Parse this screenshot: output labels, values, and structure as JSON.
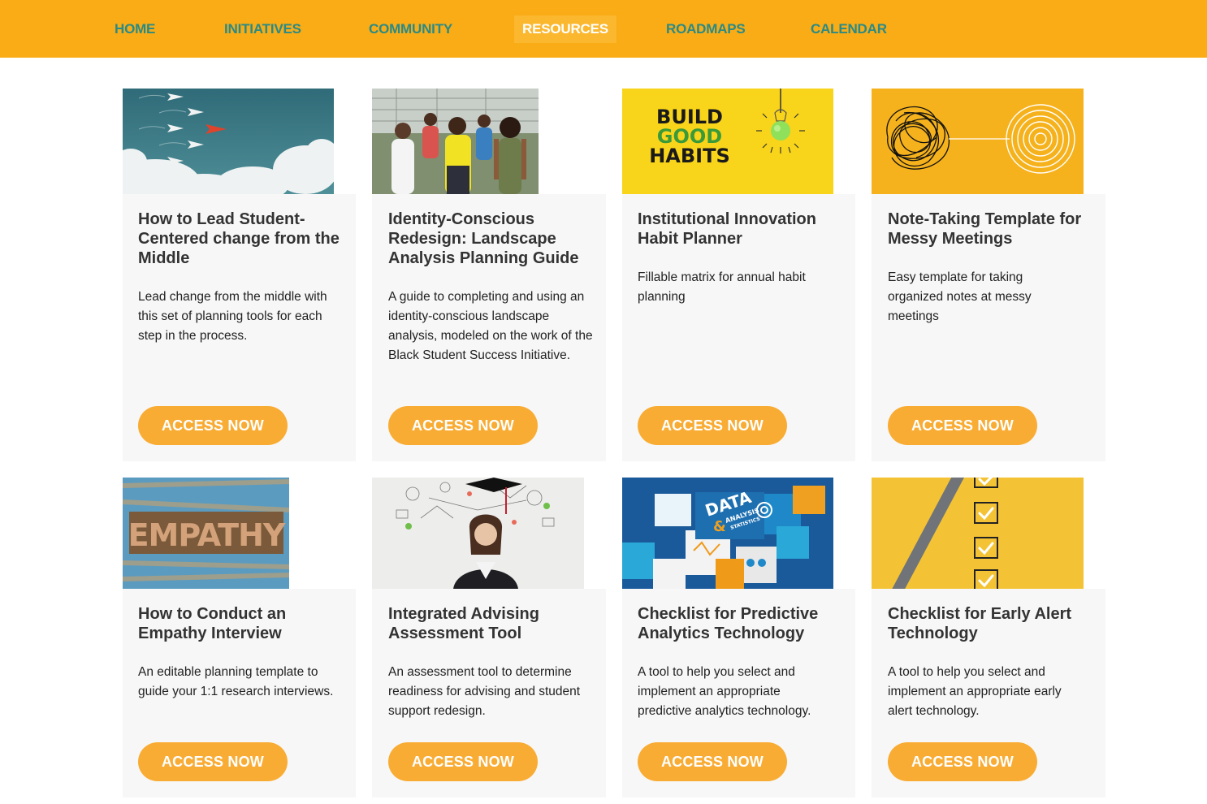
{
  "nav": {
    "items": [
      {
        "label": "HOME"
      },
      {
        "label": "INITIATIVES"
      },
      {
        "label": "COMMUNITY"
      },
      {
        "label": "RESOURCES",
        "active": true
      },
      {
        "label": "ROADMAPS"
      },
      {
        "label": "CALENDAR"
      }
    ]
  },
  "resources": [
    {
      "title": "How to Lead Student-Centered change from the Middle",
      "description": "Lead change from the middle with this set of planning tools for each step in the process.",
      "button": "ACCESS NOW",
      "image": "paper-airplanes-image"
    },
    {
      "title": "Identity-Conscious Redesign: Landscape Analysis Planning Guide",
      "description": "A guide to completing and using an identity-conscious landscape analysis, modeled on the work of the Black Student Success Initiative.",
      "button": "ACCESS NOW",
      "image": "students-walking-image"
    },
    {
      "title": "Institutional Innovation Habit Planner",
      "description": "Fillable matrix for annual habit planning",
      "button": "ACCESS NOW",
      "image": "build-good-habits-image",
      "image_text": [
        "BUILD",
        "GOOD",
        "HABITS"
      ]
    },
    {
      "title": "Note-Taking Template for Messy Meetings",
      "description": "Easy template for taking organized notes at messy meetings",
      "button": "ACCESS NOW",
      "image": "tangled-to-spiral-image"
    },
    {
      "title": "How to Conduct an Empathy Interview",
      "description": "An editable planning template to guide your 1:1 research interviews.",
      "button": "ACCESS NOW",
      "image": "empathy-letterpress-image",
      "image_text": "EMPATHY"
    },
    {
      "title": "Integrated Advising Assessment Tool",
      "description": "An assessment tool to determine readiness for advising and student support redesign.",
      "button": "ACCESS NOW",
      "image": "thinking-graduate-image"
    },
    {
      "title": "Checklist for Predictive Analytics Technology",
      "description": "A tool to help you select and implement an appropriate predictive analytics technology.",
      "button": "ACCESS NOW",
      "image": "data-analysis-cubes-image",
      "image_text": [
        "DATA",
        "ANALYSIS",
        "STATISTICS",
        "&"
      ]
    },
    {
      "title": "Checklist for Early Alert Technology",
      "description": "A tool to help you select and implement an appropriate early alert technology.",
      "button": "ACCESS NOW",
      "image": "pencil-checklist-image"
    }
  ],
  "colors": {
    "nav_bg": "#f9ac15",
    "nav_text": "#2a8a86",
    "button": "#f9ac33",
    "card_bg": "#f7f7f7"
  }
}
